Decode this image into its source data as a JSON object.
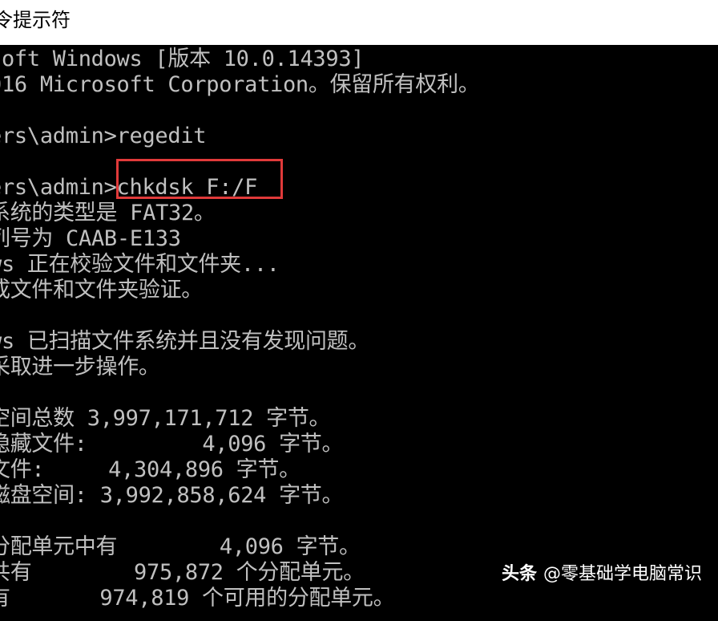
{
  "window": {
    "title": "令提示符"
  },
  "console": {
    "lines": [
      "soft Windows [版本 10.0.14393]",
      "016 Microsoft Corporation。保留所有权利。",
      "",
      "ers\\admin>regedit",
      "",
      "ers\\admin>chkdsk F:/F",
      "系统的类型是 FAT32。",
      "列号为 CAAB-E133",
      "ws 正在校验文件和文件夹...",
      "成文件和文件夹验证。",
      "",
      "ws 已扫描文件系统并且没有发现问题。",
      "采取进一步操作。",
      "",
      "空间总数 3,997,171,712 字节。",
      "隐藏文件:         4,096 字节。",
      "文件:     4,304,896 字节。",
      "磁盘空间: 3,992,858,624 字节。",
      "",
      "分配单元中有        4,096 字节。",
      "共有        975,872 个分配单元。",
      "有       974,819 个可用的分配单元。"
    ],
    "highlighted_command": "chkdsk F:/F"
  },
  "watermark": {
    "brand": "头条",
    "account": "@零基础学电脑常识"
  },
  "colors": {
    "console_bg": "#000000",
    "console_text": "#c0c0c0",
    "titlebar_bg": "#ffffff",
    "highlight_border": "#e03a3a"
  }
}
